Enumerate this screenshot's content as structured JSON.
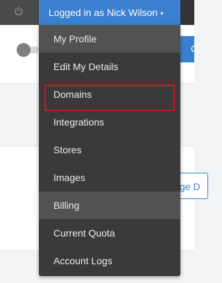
{
  "header": {
    "power_icon": "power-icon",
    "user_label": "Logged in as Nick Wilson",
    "caret": "▾"
  },
  "background": {
    "right_button_label": "C",
    "outline_button_label": "ge D"
  },
  "menu": {
    "items": [
      {
        "label": "My Profile",
        "active": true
      },
      {
        "label": "Edit My Details",
        "active": false
      },
      {
        "label": "Domains",
        "active": false,
        "highlighted": true
      },
      {
        "label": "Integrations",
        "active": false
      },
      {
        "label": "Stores",
        "active": false
      },
      {
        "label": "Images",
        "active": false
      },
      {
        "label": "Billing",
        "active": true
      },
      {
        "label": "Current Quota",
        "active": false
      },
      {
        "label": "Account Logs",
        "active": false
      }
    ]
  },
  "colors": {
    "accent": "#3b7fd0",
    "menu_bg": "#3a3a3a",
    "highlight": "#d0162a"
  }
}
